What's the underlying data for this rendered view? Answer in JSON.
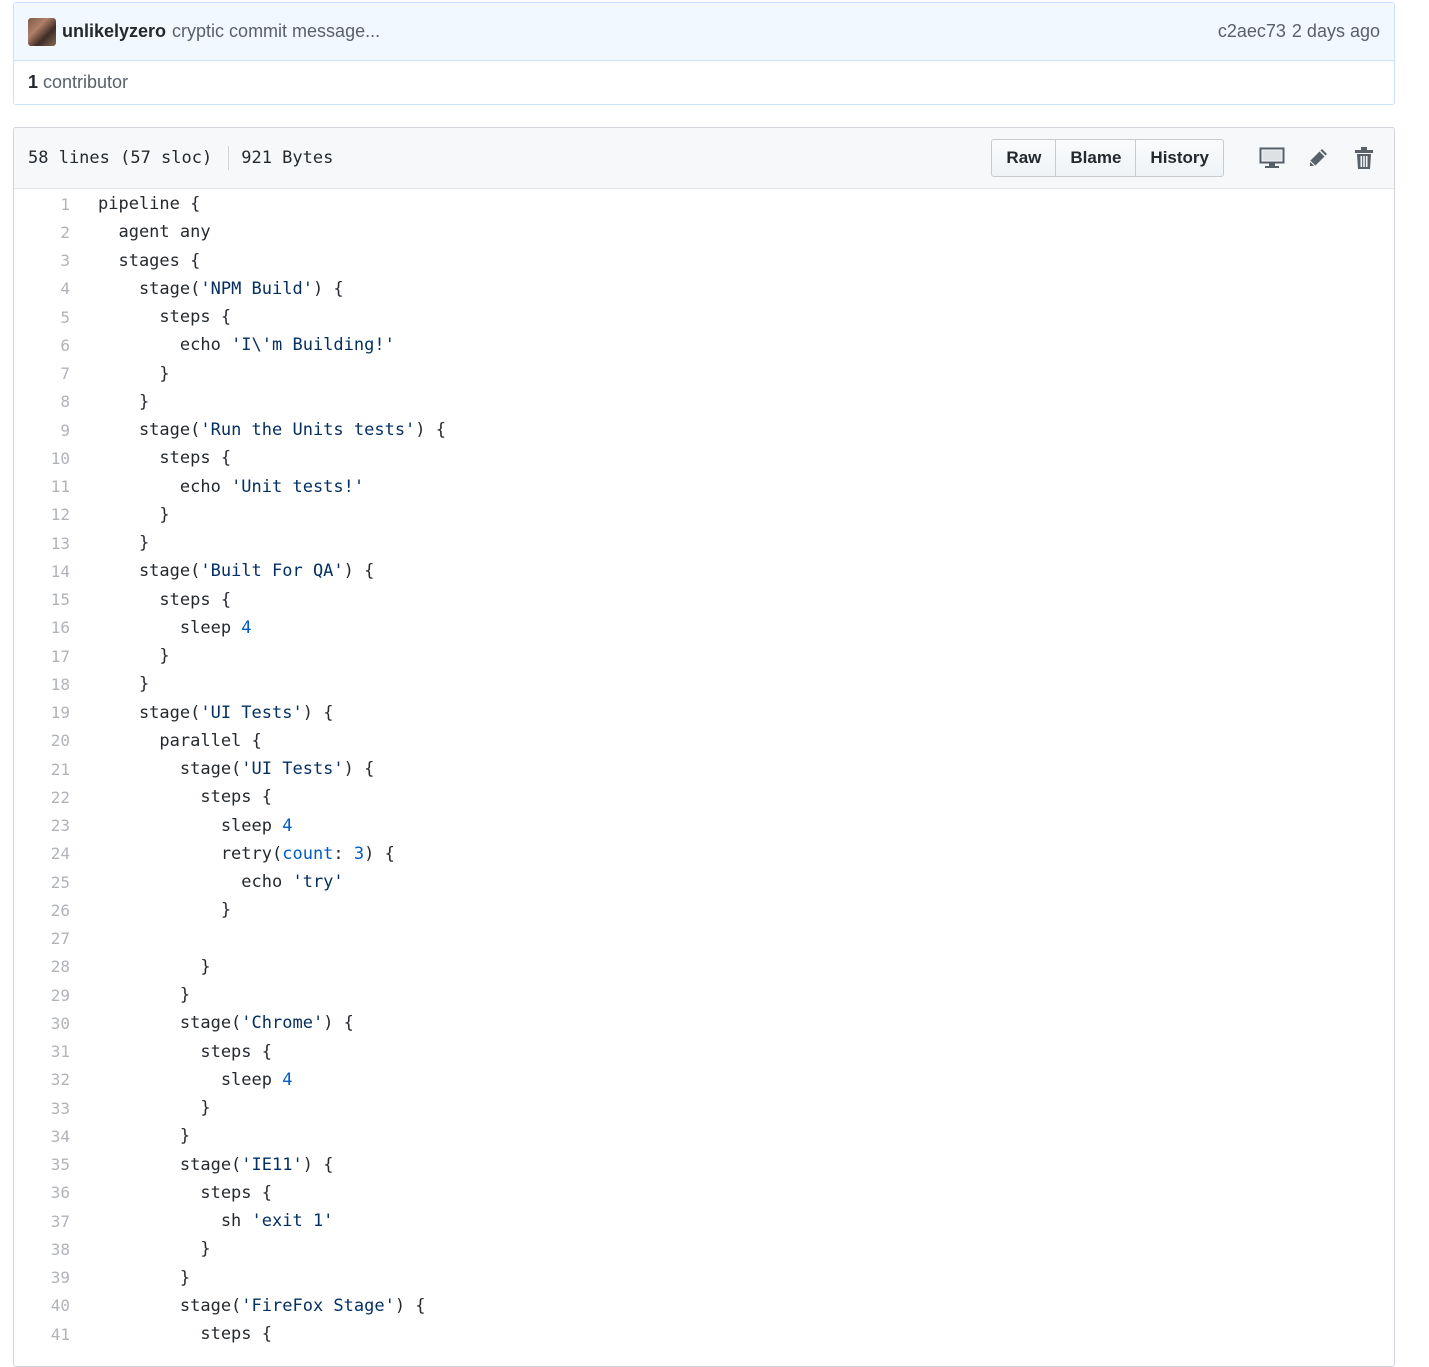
{
  "commit": {
    "author": "unlikelyzero",
    "message": "cryptic commit message...",
    "sha": "c2aec73",
    "time": "2 days ago",
    "contributors_count": "1",
    "contributors_label": "contributor"
  },
  "file": {
    "lines_info": "58 lines (57 sloc)",
    "size": "921 Bytes",
    "buttons": {
      "raw": "Raw",
      "blame": "Blame",
      "history": "History"
    },
    "icons": [
      "desktop-icon",
      "pencil-icon",
      "trash-icon"
    ]
  },
  "colors": {
    "string": "#032f62",
    "number": "#005cc5",
    "line_number": "#b0b4b9"
  },
  "code_lines": [
    [
      {
        "t": "pipeline {"
      }
    ],
    [
      {
        "t": "  agent any"
      }
    ],
    [
      {
        "t": "  stages {"
      }
    ],
    [
      {
        "t": "    stage("
      },
      {
        "t": "'NPM Build'",
        "c": "str"
      },
      {
        "t": ") {"
      }
    ],
    [
      {
        "t": "      steps {"
      }
    ],
    [
      {
        "t": "        echo "
      },
      {
        "t": "'I\\'m Building!'",
        "c": "str"
      }
    ],
    [
      {
        "t": "      }"
      }
    ],
    [
      {
        "t": "    }"
      }
    ],
    [
      {
        "t": "    stage("
      },
      {
        "t": "'Run the Units tests'",
        "c": "str"
      },
      {
        "t": ") {"
      }
    ],
    [
      {
        "t": "      steps {"
      }
    ],
    [
      {
        "t": "        echo "
      },
      {
        "t": "'Unit tests!'",
        "c": "str"
      }
    ],
    [
      {
        "t": "      }"
      }
    ],
    [
      {
        "t": "    }"
      }
    ],
    [
      {
        "t": "    stage("
      },
      {
        "t": "'Built For QA'",
        "c": "str"
      },
      {
        "t": ") {"
      }
    ],
    [
      {
        "t": "      steps {"
      }
    ],
    [
      {
        "t": "        sleep "
      },
      {
        "t": "4",
        "c": "num"
      }
    ],
    [
      {
        "t": "      }"
      }
    ],
    [
      {
        "t": "    }"
      }
    ],
    [
      {
        "t": "    stage("
      },
      {
        "t": "'UI Tests'",
        "c": "str"
      },
      {
        "t": ") {"
      }
    ],
    [
      {
        "t": "      parallel {"
      }
    ],
    [
      {
        "t": "        stage("
      },
      {
        "t": "'UI Tests'",
        "c": "str"
      },
      {
        "t": ") {"
      }
    ],
    [
      {
        "t": "          steps {"
      }
    ],
    [
      {
        "t": "            sleep "
      },
      {
        "t": "4",
        "c": "num"
      }
    ],
    [
      {
        "t": "            retry("
      },
      {
        "t": "count",
        "c": "key"
      },
      {
        "t": ": "
      },
      {
        "t": "3",
        "c": "num"
      },
      {
        "t": ") {"
      }
    ],
    [
      {
        "t": "              echo "
      },
      {
        "t": "'try'",
        "c": "str"
      }
    ],
    [
      {
        "t": "            }"
      }
    ],
    [
      {
        "t": ""
      }
    ],
    [
      {
        "t": "          }"
      }
    ],
    [
      {
        "t": "        }"
      }
    ],
    [
      {
        "t": "        stage("
      },
      {
        "t": "'Chrome'",
        "c": "str"
      },
      {
        "t": ") {"
      }
    ],
    [
      {
        "t": "          steps {"
      }
    ],
    [
      {
        "t": "            sleep "
      },
      {
        "t": "4",
        "c": "num"
      }
    ],
    [
      {
        "t": "          }"
      }
    ],
    [
      {
        "t": "        }"
      }
    ],
    [
      {
        "t": "        stage("
      },
      {
        "t": "'IE11'",
        "c": "str"
      },
      {
        "t": ") {"
      }
    ],
    [
      {
        "t": "          steps {"
      }
    ],
    [
      {
        "t": "            sh "
      },
      {
        "t": "'exit 1'",
        "c": "str"
      }
    ],
    [
      {
        "t": "          }"
      }
    ],
    [
      {
        "t": "        }"
      }
    ],
    [
      {
        "t": "        stage("
      },
      {
        "t": "'FireFox Stage'",
        "c": "str"
      },
      {
        "t": ") {"
      }
    ],
    [
      {
        "t": "          steps {"
      }
    ]
  ]
}
